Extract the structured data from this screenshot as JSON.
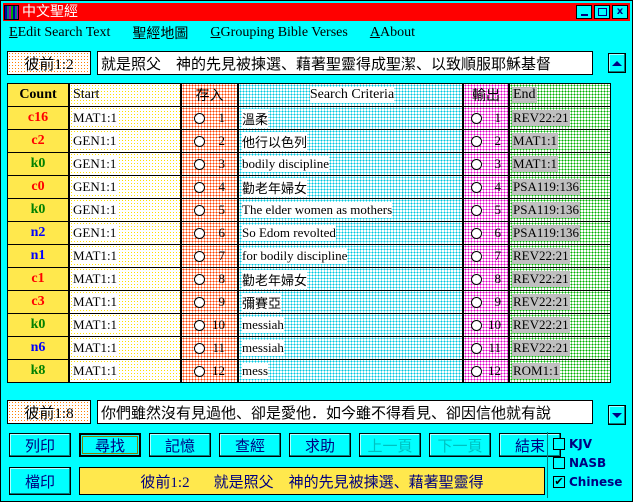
{
  "window": {
    "title": "中文聖經",
    "icon": "app-icon",
    "minimize_label": "_",
    "maximize_label": "□",
    "close_label": "x",
    "titlebar_color": "#ff0000",
    "app_background": "#00ffff"
  },
  "menu": {
    "items": [
      {
        "label": "Edit Search Text",
        "hotkey": "E"
      },
      {
        "label": "聖經地圖",
        "hotkey": ""
      },
      {
        "label": "Grouping Bible Verses",
        "hotkey": "G"
      },
      {
        "label": "About",
        "hotkey": "A"
      }
    ]
  },
  "top_verse": {
    "reference": "彼前1:2",
    "text": "就是照父　神的先見被揀選、藉著聖靈得成聖潔、以致順服耶穌基督"
  },
  "bottom_verse": {
    "reference": "彼前1:8",
    "text": "你們雖然沒有見過他、卻是愛他．如今雖不得看見、卻因信他就有說"
  },
  "grid": {
    "headers": {
      "count": "Count",
      "start": "Start",
      "save_in": "存入",
      "criteria": "Search Criteria",
      "output": "輸出",
      "end": "End"
    },
    "rows": [
      {
        "index": "1",
        "count": "c16",
        "count_color": "#ff0000",
        "start": "MAT1:1",
        "criteria": "溫柔",
        "end": "REV22:21"
      },
      {
        "index": "2",
        "count": "c2",
        "count_color": "#ff0000",
        "start": "GEN1:1",
        "criteria": "他行以色列",
        "end": "MAT1:1"
      },
      {
        "index": "3",
        "count": "k0",
        "count_color": "#008000",
        "start": "GEN1:1",
        "criteria": "bodily discipline",
        "end": "MAT1:1"
      },
      {
        "index": "4",
        "count": "c0",
        "count_color": "#ff0000",
        "start": "GEN1:1",
        "criteria": "勸老年婦女",
        "end": "PSA119:136"
      },
      {
        "index": "5",
        "count": "k0",
        "count_color": "#008000",
        "start": "GEN1:1",
        "criteria": "The elder women as mothers",
        "end": "PSA119:136"
      },
      {
        "index": "6",
        "count": "n2",
        "count_color": "#0000ff",
        "start": "GEN1:1",
        "criteria": "So Edom revolted",
        "end": "PSA119:136"
      },
      {
        "index": "7",
        "count": "n1",
        "count_color": "#0000ff",
        "start": "MAT1:1",
        "criteria": "for bodily discipline",
        "end": "REV22:21"
      },
      {
        "index": "8",
        "count": "c1",
        "count_color": "#ff0000",
        "start": "MAT1:1",
        "criteria": "勸老年婦女",
        "end": "REV22:21"
      },
      {
        "index": "9",
        "count": "c3",
        "count_color": "#ff0000",
        "start": "MAT1:1",
        "criteria": "彌賽亞",
        "end": "REV22:21"
      },
      {
        "index": "10",
        "count": "k0",
        "count_color": "#008000",
        "start": "MAT1:1",
        "criteria": "messiah",
        "end": "REV22:21"
      },
      {
        "index": "11",
        "count": "n6",
        "count_color": "#0000ff",
        "start": "MAT1:1",
        "criteria": "messiah",
        "end": "REV22:21"
      },
      {
        "index": "12",
        "count": "k8",
        "count_color": "#008000",
        "start": "MAT1:1",
        "criteria": "mess",
        "end": "ROM1:1"
      }
    ]
  },
  "scroll": {
    "up_glyph": "▲",
    "down_glyph": "▼"
  },
  "buttons": [
    {
      "label": "列印",
      "name": "print-button",
      "state": "normal"
    },
    {
      "label": "尋找",
      "name": "search-button",
      "state": "focused"
    },
    {
      "label": "記憶",
      "name": "memory-button",
      "state": "normal"
    },
    {
      "label": "查經",
      "name": "study-button",
      "state": "normal"
    },
    {
      "label": "求助",
      "name": "help-button",
      "state": "normal"
    },
    {
      "label": "上一頁",
      "name": "prev-page-button",
      "state": "disabled"
    },
    {
      "label": "下一頁",
      "name": "next-page-button",
      "state": "disabled"
    },
    {
      "label": "結束",
      "name": "exit-button",
      "state": "normal"
    }
  ],
  "file_button": {
    "label": "檔印"
  },
  "status_bar": {
    "reference": "彼前1:2",
    "text": "就是照父　神的先見被揀選、藉著聖靈得"
  },
  "versions": [
    {
      "label": "KJV",
      "checked": false,
      "mark": ""
    },
    {
      "label": "NASB",
      "checked": false,
      "mark": ""
    },
    {
      "label": "Chinese",
      "checked": true,
      "mark": "✔"
    }
  ]
}
